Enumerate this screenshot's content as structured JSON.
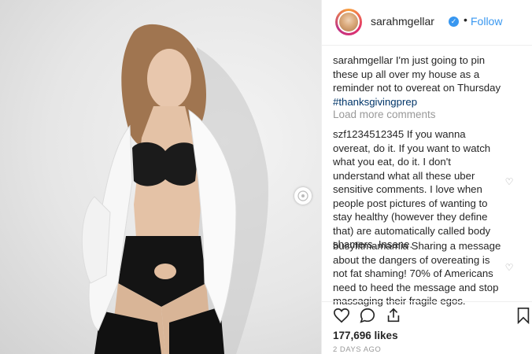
{
  "post": {
    "username": "sarahmgellar",
    "separator": "•",
    "follow_label": "Follow",
    "caption_user": "sarahmgellar",
    "caption_text": " I'm just going to pin these up all over my house as a reminder not to overeat on Thursday",
    "caption_tag": "#thanksgivingprep",
    "load_more_label": "Load more comments",
    "likes": "177,696 likes",
    "timestamp": "2 DAYS AGO"
  },
  "comments": [
    {
      "user": "szf1234512345",
      "text": " If you wanna overeat, do it. If you want to watch what you eat, do it. I don't understand what all these uber sensitive comments. I love when people post pictures of wanting to stay healthy (however they define that) are automatically called body shamers. Insane."
    },
    {
      "user": "busyfitmamamia",
      "text": " Sharing a message about the dangers of overeating is not fat shaming! 70% of Americans need to heed the message and stop massaging their fragile egos."
    }
  ],
  "icons": {
    "verified": "verified-badge-icon",
    "like": "heart-icon",
    "comment": "comment-bubble-icon",
    "share": "share-icon",
    "save": "bookmark-icon",
    "carousel": "carousel-next-icon"
  },
  "colors": {
    "link_blue": "#3897f0",
    "hashtag": "#003569",
    "muted": "#999999",
    "text": "#262626"
  }
}
